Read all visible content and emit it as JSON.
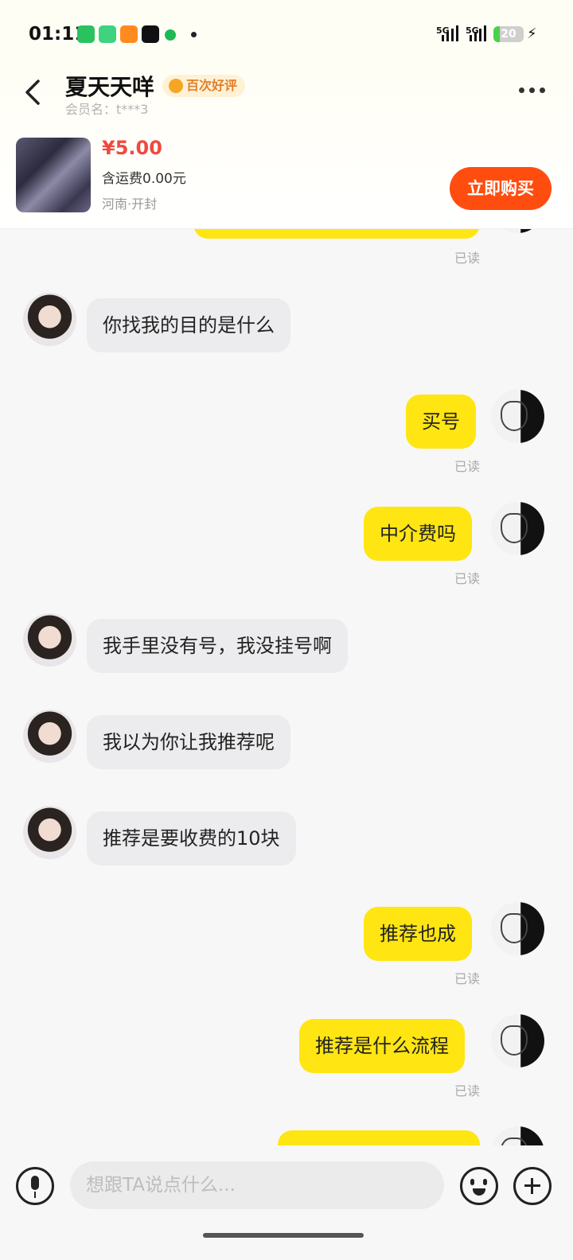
{
  "status_bar": {
    "time": "01:11",
    "signal_1": "5G",
    "signal_2": "5G",
    "battery_level": "20",
    "battery_color": "#4ad04a",
    "icons": [
      "wechat-icon",
      "wallet-icon",
      "game-icon",
      "tiktok-icon",
      "spotify-icon",
      "dot-icon",
      "charging-icon"
    ]
  },
  "header": {
    "seller_name": "夏天天咩",
    "badge": "百次好评",
    "member_label": "会员名：t***3"
  },
  "product": {
    "price": "¥5.00",
    "shipping": "含运费0.00元",
    "location": "河南·开封",
    "buy_label": "立即购买"
  },
  "messages": [
    {
      "side": "out",
      "text": "",
      "read": "已读",
      "partial": true
    },
    {
      "side": "in",
      "text": "你找我的目的是什么"
    },
    {
      "side": "out",
      "text": "买号",
      "read": "已读"
    },
    {
      "side": "out",
      "text": "中介费吗",
      "read": "已读"
    },
    {
      "side": "in",
      "text": "我手里没有号，我没挂号啊"
    },
    {
      "side": "in",
      "text": "我以为你让我推荐呢"
    },
    {
      "side": "in",
      "text": "推荐是要收费的10块"
    },
    {
      "side": "out",
      "text": "推荐也成",
      "read": "已读"
    },
    {
      "side": "out",
      "text": "推荐是什么流程",
      "read": "已读"
    },
    {
      "side": "out",
      "text": "",
      "partial": true
    }
  ],
  "input": {
    "placeholder": "想跟TA说点什么..."
  },
  "colors": {
    "accent_yellow": "#ffe512",
    "buy_orange": "#ff4d0f",
    "price_red": "#f0493e"
  }
}
